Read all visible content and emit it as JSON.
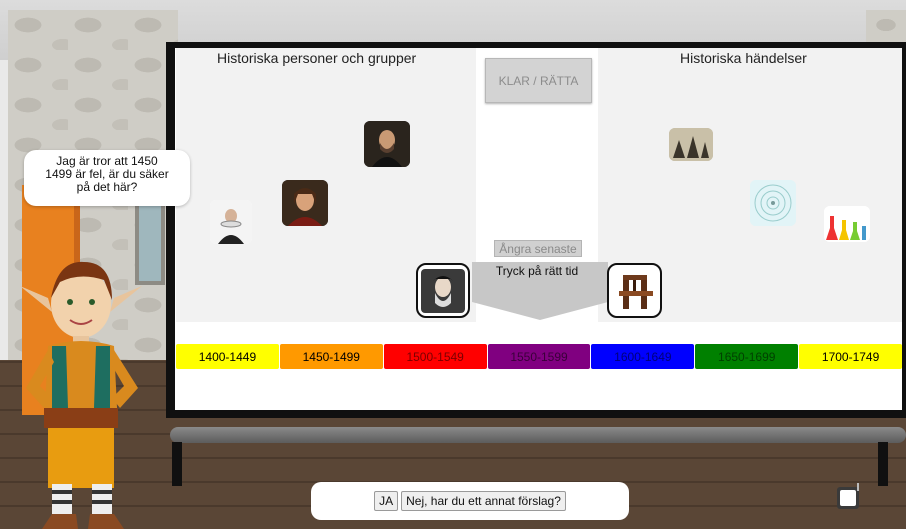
{
  "board": {
    "left_heading": "Historiska personer och grupper",
    "right_heading": "Historiska händelser",
    "check_button": "KLAR / RÄTTA",
    "undo_button": "Ångra senaste",
    "instruction": "Tryck på rätt tid"
  },
  "timeline": [
    {
      "label": "1400-1449",
      "color": "#ffff00",
      "text_color": "#000000"
    },
    {
      "label": "1450-1499",
      "color": "#ff9900",
      "text_color": "#000000"
    },
    {
      "label": "1500-1549",
      "color": "#ff0000",
      "text_color": "#7a0000"
    },
    {
      "label": "1550-1599",
      "color": "#800080",
      "text_color": "#3a003a"
    },
    {
      "label": "1600-1649",
      "color": "#0000ff",
      "text_color": "#00007a"
    },
    {
      "label": "1650-1699",
      "color": "#008000",
      "text_color": "#004000"
    },
    {
      "label": "1700-1749",
      "color": "#ffff00",
      "text_color": "#000000"
    }
  ],
  "dialog": {
    "speech": "Jag är tror att 1450 1499 är fel, är du säker på det här?",
    "yes_button": "JA",
    "no_button": "Nej, har du ett annat förslag?"
  },
  "icons": {
    "person_cards": [
      "portrait-icon",
      "portrait-icon",
      "portrait-icon"
    ],
    "event_cards": [
      "engraving-icon",
      "bubble-chamber-icon",
      "flasks-icon"
    ],
    "selected_person": "portrait-icon",
    "selected_event": "printing-press-icon",
    "exit": "door-exit-icon"
  }
}
